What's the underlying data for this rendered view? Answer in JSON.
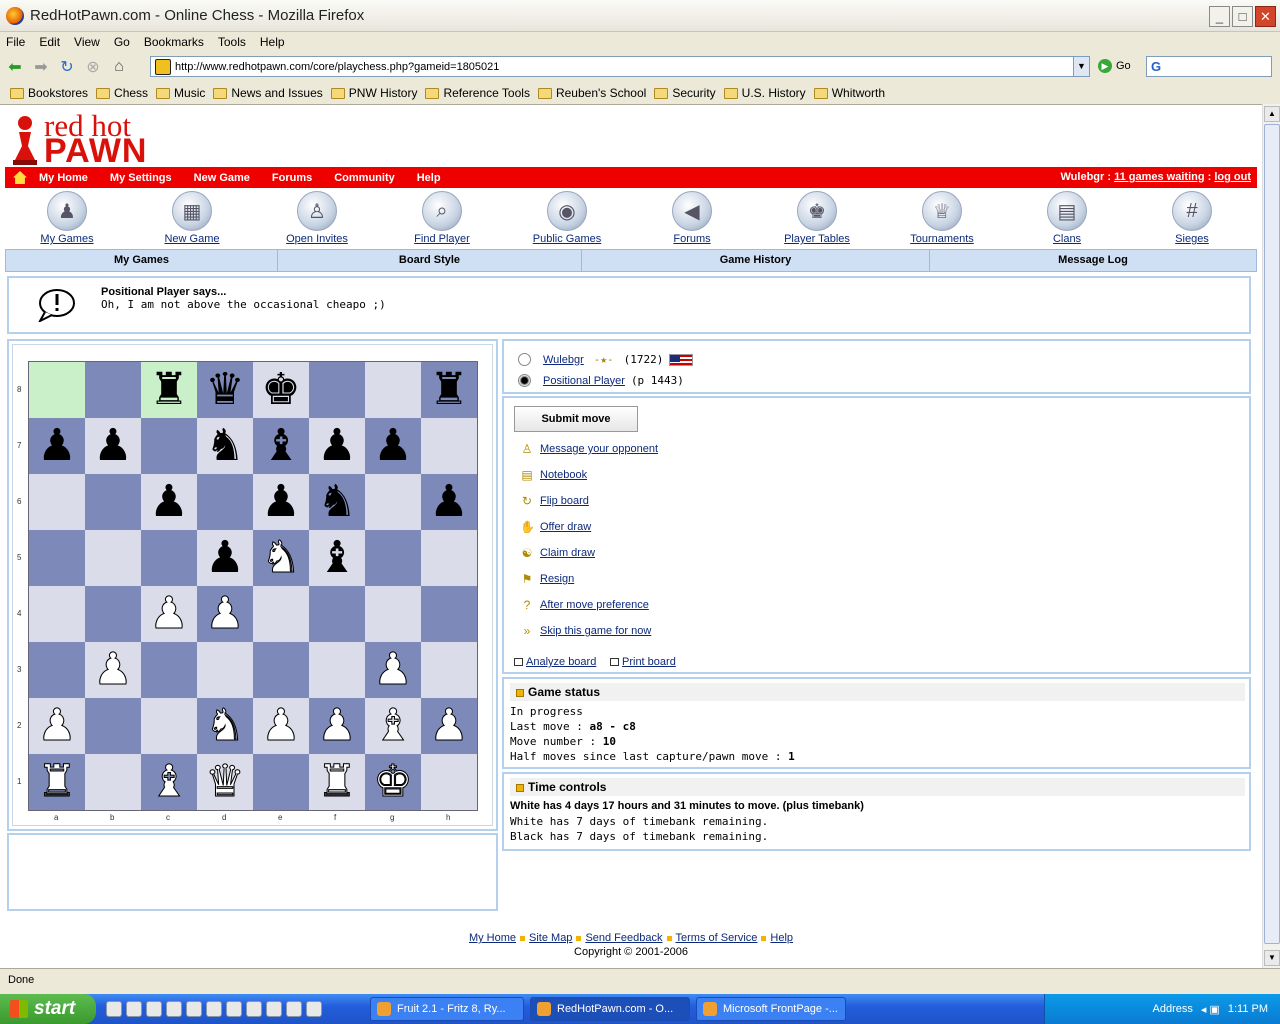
{
  "window": {
    "title": "RedHotPawn.com - Online Chess - Mozilla Firefox"
  },
  "menu": [
    "File",
    "Edit",
    "View",
    "Go",
    "Bookmarks",
    "Tools",
    "Help"
  ],
  "url": "http://www.redhotpawn.com/core/playchess.php?gameid=1805021",
  "go_label": "Go",
  "bookmarks": [
    "Bookstores",
    "Chess",
    "Music",
    "News and Issues",
    "PNW History",
    "Reference Tools",
    "Reuben's School",
    "Security",
    "U.S. History",
    "Whitworth"
  ],
  "logo": {
    "line1": "red hot",
    "line2": "PAWN"
  },
  "topnav": [
    "My Home",
    "My Settings",
    "New Game",
    "Forums",
    "Community",
    "Help"
  ],
  "user": {
    "name": "Wulebgr",
    "sep1": " : ",
    "waiting": "11 games waiting",
    "sep2": " : ",
    "logout": "log out"
  },
  "icons": [
    {
      "label": "My Games",
      "glyph": "♟"
    },
    {
      "label": "New Game",
      "glyph": "▦"
    },
    {
      "label": "Open Invites",
      "glyph": "♙"
    },
    {
      "label": "Find Player",
      "glyph": "⌕"
    },
    {
      "label": "Public Games",
      "glyph": "◉"
    },
    {
      "label": "Forums",
      "glyph": "◀"
    },
    {
      "label": "Player Tables",
      "glyph": "♚"
    },
    {
      "label": "Tournaments",
      "glyph": "♕"
    },
    {
      "label": "Clans",
      "glyph": "▤"
    },
    {
      "label": "Sieges",
      "glyph": "#"
    }
  ],
  "tabs": [
    "My Games",
    "Board Style",
    "Game History",
    "Message Log"
  ],
  "message": {
    "who": "Positional Player says...",
    "text": "Oh, I am not above the occasional cheapo ;)"
  },
  "board": {
    "files": [
      "a",
      "b",
      "c",
      "d",
      "e",
      "f",
      "g",
      "h"
    ],
    "ranks": [
      "8",
      "7",
      "6",
      "5",
      "4",
      "3",
      "2",
      "1"
    ],
    "position": [
      [
        "",
        "",
        "r",
        "q",
        "k",
        "",
        "",
        "r"
      ],
      [
        "p",
        "p",
        "",
        "n",
        "b",
        "p",
        "p",
        ""
      ],
      [
        "",
        "",
        "p",
        "",
        "p",
        "n",
        "",
        "p"
      ],
      [
        "",
        "",
        "",
        "p",
        "N",
        "b",
        "",
        ""
      ],
      [
        "",
        "",
        "P",
        "P",
        "",
        "",
        "",
        ""
      ],
      [
        "",
        "P",
        "",
        "",
        "",
        "",
        "P",
        ""
      ],
      [
        "P",
        "",
        "",
        "N",
        "P",
        "P",
        "B",
        "P"
      ],
      [
        "R",
        "",
        "B",
        "Q",
        "",
        "R",
        "K",
        ""
      ]
    ],
    "highlight": [
      "a8",
      "c8"
    ]
  },
  "players": [
    {
      "name": "Wulebgr",
      "rating": "(1722)",
      "color": "white"
    },
    {
      "name": "Positional Player",
      "rating": "(p 1443)",
      "color": "black"
    }
  ],
  "submit_label": "Submit move",
  "actions": [
    {
      "label": "Message your opponent",
      "icon": "person-icon"
    },
    {
      "label": "Notebook",
      "icon": "notebook-icon"
    },
    {
      "label": "Flip board",
      "icon": "flip-icon"
    },
    {
      "label": "Offer draw",
      "icon": "handshake-icon"
    },
    {
      "label": "Claim draw",
      "icon": "claim-icon"
    },
    {
      "label": "Resign",
      "icon": "flag-icon"
    },
    {
      "label": "After move preference",
      "icon": "question-icon"
    },
    {
      "label": "Skip this game for now",
      "icon": "skip-icon"
    }
  ],
  "analyze_label": "Analyze board",
  "print_label": "Print board",
  "status": {
    "title": "Game status",
    "state": "In progress",
    "last_move_label": "Last move : ",
    "last_move": "a8 - c8",
    "move_number_label": "Move number : ",
    "move_number": "10",
    "half_moves_label": "Half moves since last capture/pawn move : ",
    "half_moves": "1"
  },
  "time": {
    "title": "Time controls",
    "line1": "White has 4 days 17 hours and 31 minutes to move. (plus timebank)",
    "line2": "White has 7 days of timebank remaining.",
    "line3": "Black has 7 days of timebank remaining."
  },
  "footer": {
    "links": [
      "My Home",
      "Site Map",
      "Send Feedback",
      "Terms of Service",
      "Help"
    ],
    "copyright": "Copyright © 2001-2006"
  },
  "statusbar": "Done",
  "taskbar": {
    "start": "start",
    "tasks": [
      "Fruit 2.1 - Fritz 8, Ry...",
      "RedHotPawn.com - O...",
      "Microsoft FrontPage -..."
    ],
    "address": "Address",
    "clock": "1:11 PM"
  }
}
